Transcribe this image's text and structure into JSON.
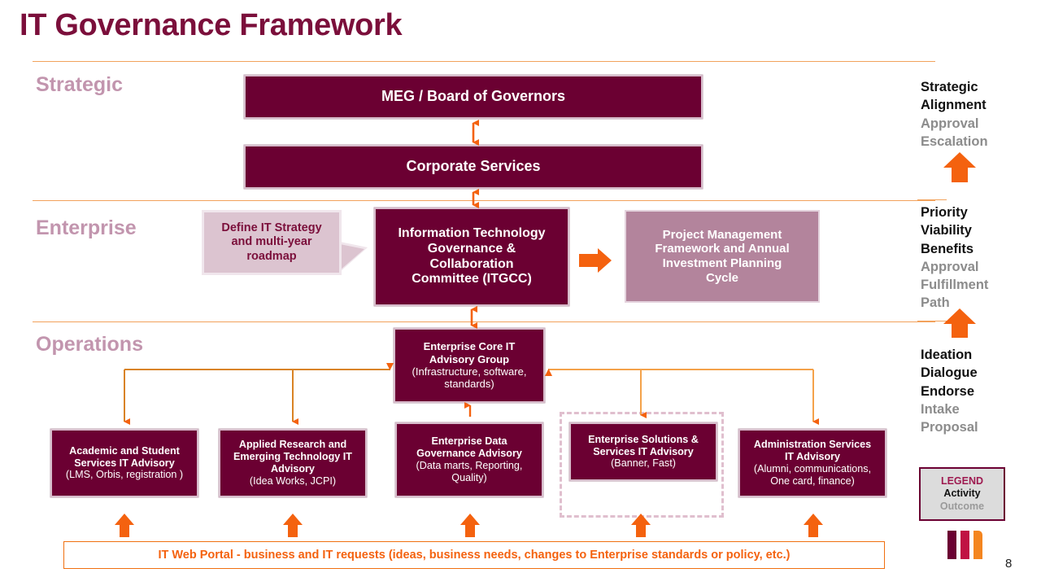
{
  "page": {
    "title": "IT Governance Framework",
    "number": "8"
  },
  "tiers": [
    {
      "id": "strategic",
      "label": "Strategic"
    },
    {
      "id": "enterprise",
      "label": "Enterprise"
    },
    {
      "id": "operations",
      "label": "Operations"
    }
  ],
  "strategic": {
    "meg": "MEG / Board of Governors",
    "corporate_services": "Corporate Services"
  },
  "enterprise": {
    "callout": {
      "line1": "Define IT Strategy",
      "line2": "and multi-year",
      "line3": "roadmap"
    },
    "itgcc": {
      "line1": "Information  Technology",
      "line2": "Governance  &",
      "line3": "Collaboration",
      "line4": "Committee (ITGCC)"
    },
    "pmf": {
      "line1": "Project  Management",
      "line2": "Framework and  Annual",
      "line3": "Investment Planning",
      "line4": "Cycle"
    }
  },
  "operations": {
    "core": {
      "line1": "Enterprise Core  IT",
      "line2": "Advisory Group",
      "line3": "(Infrastructure,  software,",
      "line4": "standards)"
    },
    "advisories": [
      {
        "id": "academic",
        "line1": "Academic and Student",
        "line2": "Services IT Advisory",
        "line3": "(LMS, Orbis, registration )",
        "line4": ""
      },
      {
        "id": "applied-research",
        "line1": "Applied Research and",
        "line2": "Emerging Technology IT",
        "line3": "Advisory",
        "line4": "(Idea Works,  JCPI)"
      },
      {
        "id": "data-governance",
        "line1": "Enterprise Data",
        "line2": "Governance Advisory",
        "line3": "(Data marts,  Reporting,",
        "line4": "Quality)"
      },
      {
        "id": "solutions-services",
        "line1": "Enterprise Solutions &",
        "line2": "Services IT Advisory",
        "line3": "(Banner, Fast)",
        "line4": ""
      },
      {
        "id": "administration",
        "line1": "Administration  Services",
        "line2": "IT Advisory",
        "line3": "(Alumni, communications,",
        "line4": "One card, finance)"
      }
    ],
    "web_portal": "IT Web Portal - business and IT requests (ideas, business needs, changes to Enterprise standards or policy, etc.)"
  },
  "annotations": {
    "strategic": {
      "activity_1": "Strategic",
      "activity_2": "Alignment",
      "outcome_1": "Approval",
      "outcome_2": "Escalation"
    },
    "enterprise": {
      "activity_1": "Priority",
      "activity_2": "Viability",
      "activity_3": "Benefits",
      "outcome_1": "Approval",
      "outcome_2": "Fulfillment",
      "outcome_3": "Path"
    },
    "operations": {
      "activity_1": "Ideation",
      "activity_2": "Dialogue",
      "activity_3": "Endorse",
      "outcome_1": "Intake",
      "outcome_2": "Proposal"
    }
  },
  "legend": {
    "title": "LEGEND",
    "activity": "Activity",
    "outcome": "Outcome"
  },
  "colors": {
    "maroon": "#6B0032",
    "title_maroon": "#7B0F3B",
    "mauve": "#B3849C",
    "callout_fill": "#DCC4D0",
    "tier_label": "#C295AE",
    "orange": "#F4620F",
    "divider_orange": "#F2A25C",
    "dashed_pink": "#E0BFCE",
    "crimson": "#C01243",
    "legend_bg": "#DCDCDC",
    "outcome_gray": "#8C8C8C"
  }
}
